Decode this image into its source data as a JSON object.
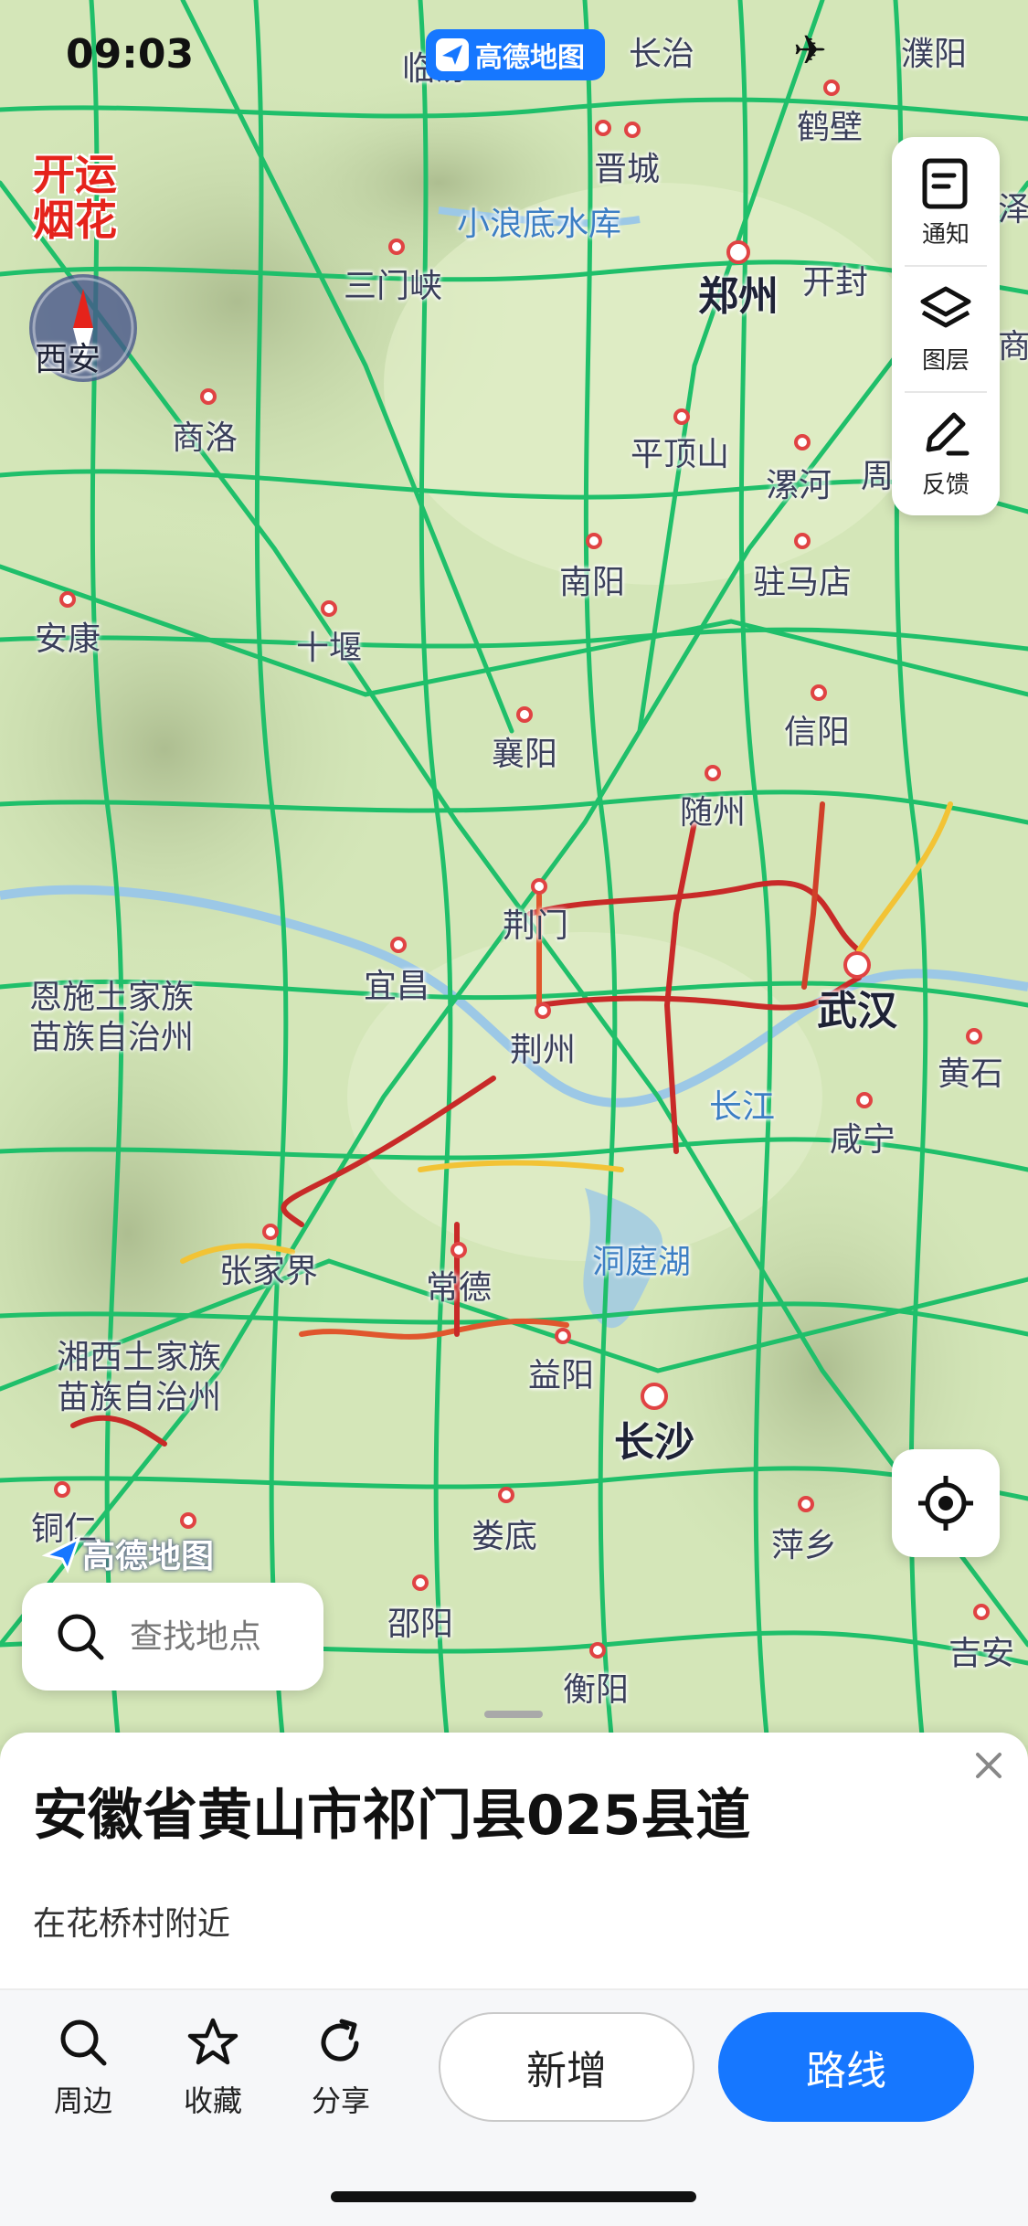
{
  "status_bar": {
    "time": "09:03",
    "airplane_icon": "airplane-icon"
  },
  "app": {
    "logo_text": "高德地图",
    "watermark_text": "高德地图",
    "promo_text": "开运\n烟花"
  },
  "map": {
    "compass_label": "西安",
    "cities": [
      {
        "name": "临汾",
        "kind": "normal"
      },
      {
        "name": "长治",
        "kind": "normal"
      },
      {
        "name": "濮阳",
        "kind": "normal"
      },
      {
        "name": "鹤壁",
        "kind": "normal"
      },
      {
        "name": "晋城",
        "kind": "normal"
      },
      {
        "name": "泽",
        "kind": "normal"
      },
      {
        "name": "小浪底水库",
        "kind": "water"
      },
      {
        "name": "三门峡",
        "kind": "normal"
      },
      {
        "name": "郑州",
        "kind": "major"
      },
      {
        "name": "开封",
        "kind": "normal"
      },
      {
        "name": "商",
        "kind": "normal"
      },
      {
        "name": "商洛",
        "kind": "normal"
      },
      {
        "name": "平顶山",
        "kind": "normal"
      },
      {
        "name": "漯河",
        "kind": "normal"
      },
      {
        "name": "周",
        "kind": "normal"
      },
      {
        "name": "南阳",
        "kind": "normal"
      },
      {
        "name": "驻马店",
        "kind": "normal"
      },
      {
        "name": "安康",
        "kind": "normal"
      },
      {
        "name": "十堰",
        "kind": "normal"
      },
      {
        "name": "信阳",
        "kind": "normal"
      },
      {
        "name": "襄阳",
        "kind": "normal"
      },
      {
        "name": "随州",
        "kind": "normal"
      },
      {
        "name": "荆门",
        "kind": "normal"
      },
      {
        "name": "恩施土家族\n苗族自治州",
        "kind": "multi"
      },
      {
        "name": "宜昌",
        "kind": "normal"
      },
      {
        "name": "武汉",
        "kind": "major"
      },
      {
        "name": "荆州",
        "kind": "normal"
      },
      {
        "name": "黄石",
        "kind": "normal"
      },
      {
        "name": "长江",
        "kind": "water"
      },
      {
        "name": "咸宁",
        "kind": "normal"
      },
      {
        "name": "张家界",
        "kind": "normal"
      },
      {
        "name": "常德",
        "kind": "normal"
      },
      {
        "name": "洞庭湖",
        "kind": "water"
      },
      {
        "name": "湘西土家族\n苗族自治州",
        "kind": "multi"
      },
      {
        "name": "益阳",
        "kind": "normal"
      },
      {
        "name": "长沙",
        "kind": "major"
      },
      {
        "name": "铜仁",
        "kind": "normal"
      },
      {
        "name": "娄底",
        "kind": "normal"
      },
      {
        "name": "萍乡",
        "kind": "normal"
      },
      {
        "name": "邵阳",
        "kind": "normal"
      },
      {
        "name": "吉安",
        "kind": "normal"
      },
      {
        "name": "衡阳",
        "kind": "normal"
      }
    ]
  },
  "tools": [
    {
      "label": "通知",
      "icon": "notice-icon"
    },
    {
      "label": "图层",
      "icon": "layers-icon"
    },
    {
      "label": "反馈",
      "icon": "feedback-icon"
    }
  ],
  "search": {
    "placeholder": "查找地点"
  },
  "place": {
    "title": "安徽省黄山市祁门县025县道",
    "subtitle": "在花桥村附近"
  },
  "actions": {
    "nearby": "周边",
    "favorite": "收藏",
    "share": "分享",
    "add": "新增",
    "route": "路线"
  },
  "colors": {
    "accent": "#1677ff",
    "road_clear": "#1fbf6a",
    "road_slow": "#f2c335",
    "road_jam": "#c82a28"
  }
}
